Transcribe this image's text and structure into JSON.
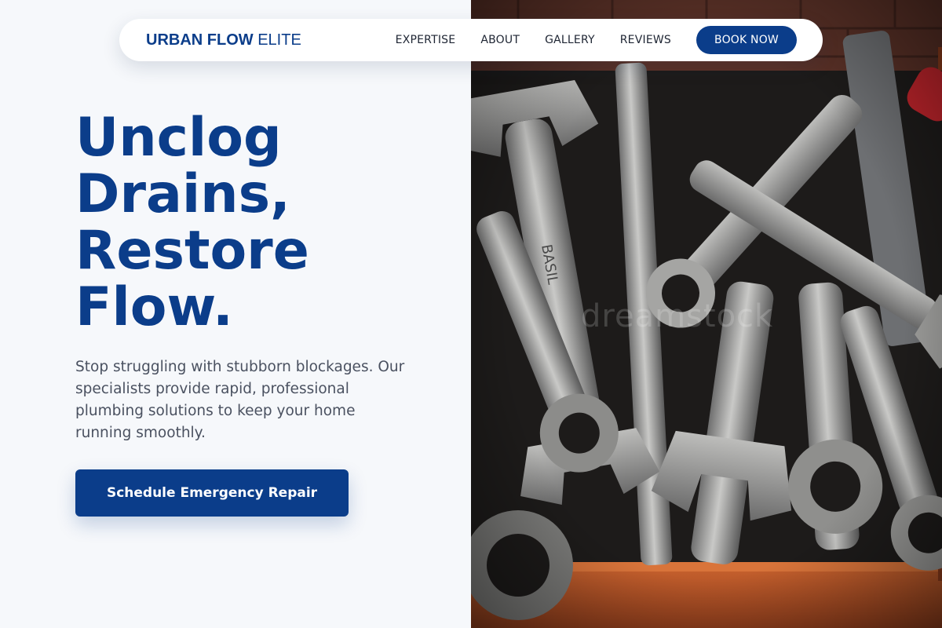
{
  "brand": {
    "name_bold": "URBAN FLOW",
    "name_light": "ELITE"
  },
  "nav": {
    "links": [
      "EXPERTISE",
      "ABOUT",
      "GALLERY",
      "REVIEWS"
    ],
    "cta_label": "BOOK NOW"
  },
  "hero": {
    "title_lines": [
      "Unclog",
      "Drains,",
      "Restore",
      "Flow."
    ],
    "subtitle": "Stop struggling with stubborn blockages. Our specialists provide rapid, professional plumbing solutions to keep your home running smoothly.",
    "cta_label": "Schedule Emergency Repair",
    "image_subject": "tray of assorted steel wrenches",
    "watermark": "dreamstock"
  },
  "colors": {
    "brand_blue": "#0b3d8a",
    "background": "#f6f8fb",
    "body_text": "#4a5160",
    "nav_text": "#1e2533",
    "tray_orange": "#b4532a"
  }
}
